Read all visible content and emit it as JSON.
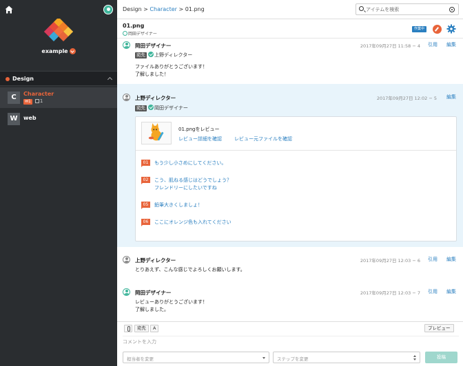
{
  "sidebar": {
    "user_name": "example",
    "group_label": "Design",
    "items": [
      {
        "initial": "C",
        "label": "Character",
        "comment_count": "1",
        "review_count": "1"
      },
      {
        "initial": "W",
        "label": "web"
      }
    ]
  },
  "topbar": {
    "crumb_root": "Design >",
    "crumb_link": "Character",
    "crumb_tail": "> 01.png",
    "search_placeholder": "アイテムを検索"
  },
  "file": {
    "name": "01.png",
    "owner": "岡田デザイナー",
    "status": "作業中"
  },
  "labels": {
    "to": "宛先",
    "quote": "引用",
    "edit": "編集"
  },
  "comments": [
    {
      "author": "岡田デザイナー",
      "to": "上野ディレクター",
      "timestamp": "2017年09月27日 11:58 − 4",
      "lines": [
        "ファイルありがとうございます！",
        "了解しました！"
      ]
    },
    {
      "author": "上野ディレクター",
      "to": "岡田デザイナー",
      "timestamp": "2017年09月27日 12:02 − 5",
      "review": {
        "title": "01.pngをレビュー",
        "link_detail": "レビュー詳細を確認",
        "link_source": "レビュー元ファイルを確認",
        "items": [
          {
            "num": "01",
            "text": "もう少し小さめにしてください。"
          },
          {
            "num": "02",
            "text": "こう、肌ねる感じはどうでしょう？",
            "text2": "フレンドリーにしたいですね"
          },
          {
            "num": "05",
            "text": "鉛筆大きくしましょ！"
          },
          {
            "num": "06",
            "text": "ここにオレンジ色も入れてください"
          }
        ]
      }
    },
    {
      "author": "上野ディレクター",
      "timestamp": "2017年09月27日 12:03 − 6",
      "lines": [
        "とりあえず、こんな感じでよろしくお願いします。"
      ]
    },
    {
      "author": "岡田デザイナー",
      "timestamp": "2017年09月27日 12:03 − 7",
      "lines": [
        "レビューありがとうございます！",
        "了解しました。"
      ]
    }
  ],
  "composer": {
    "to_button": "宛先",
    "format_button": "A",
    "preview_button": "プレビュー",
    "input_placeholder": "コメントを入力",
    "assignee_placeholder": "担当者を変更",
    "step_placeholder": "ステップを変更",
    "post_button": "投稿"
  },
  "colors": {
    "accent": "#e8643a",
    "link": "#2a7fc0",
    "success": "#3fb59b",
    "sidebar_bg": "#2a2d30"
  }
}
